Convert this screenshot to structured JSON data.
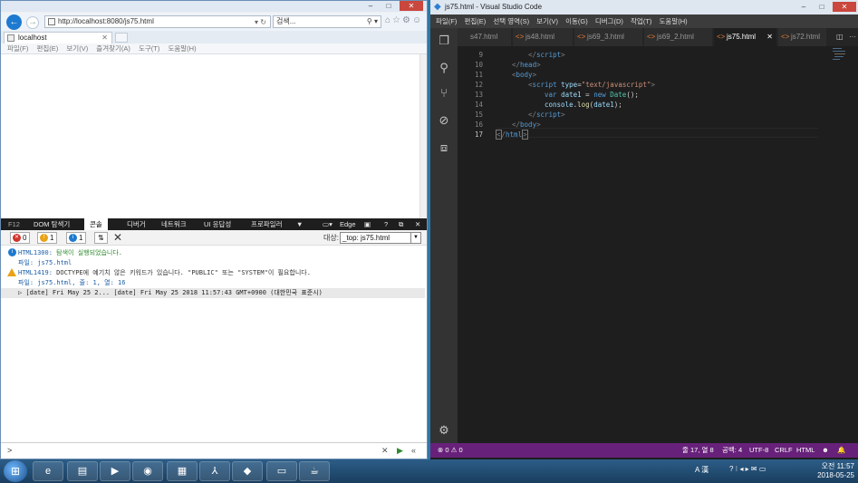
{
  "ie": {
    "title": "",
    "url": "http://localhost:8080/js75.html",
    "search_placeholder": "검색...",
    "tab_title": "localhost",
    "menu": [
      "파일(F)",
      "편집(E)",
      "보기(V)",
      "즐겨찾기(A)",
      "도구(T)",
      "도움말(H)"
    ]
  },
  "f12": {
    "tabs": [
      "F12",
      "DOM 탐색기",
      "콘솔",
      "디버거",
      "네트워크",
      "UI 응답성",
      "프로파일러",
      "Edge"
    ],
    "active_tab": "콘솔",
    "error_count": "0",
    "warning_count": "1",
    "info_count": "1",
    "target_label": "대상:",
    "target_value": "_top: js75.html",
    "messages": [
      {
        "type": "info",
        "code": "HTML1300:",
        "text": "탐색이 실행되었습니다.",
        "file": "파일: js75.html"
      },
      {
        "type": "warning",
        "code": "HTML1419:",
        "text": "DOCTYPE에 예기치 않은 키워드가 있습니다. \"PUBLIC\" 또는 \"SYSTEM\"이 필요합니다.",
        "file": "파일: js75.html, 줄: 1, 열: 16"
      }
    ],
    "date_log": "▷ [date] Fri May 25 2...  [date] Fri May 25 2018 11:57:43 GMT+0900 (대한민국 표준시)",
    "prompt": ">"
  },
  "vscode": {
    "title": "js75.html - Visual Studio Code",
    "menu": [
      "파일(F)",
      "편집(E)",
      "선택 영역(S)",
      "보기(V)",
      "이동(G)",
      "디버그(D)",
      "작업(T)",
      "도움말(H)"
    ],
    "tabs": [
      "s47.html",
      "js48.html",
      "js69_3.html",
      "js69_2.html",
      "js75.html",
      "js72.html"
    ],
    "active_tab": "js75.html",
    "line_numbers": [
      "9",
      "10",
      "11",
      "12",
      "13",
      "14",
      "15",
      "16",
      "17"
    ],
    "status": {
      "errors": "0",
      "warnings": "0",
      "position": "줄 17, 열 8",
      "spaces": "공백: 4",
      "encoding": "UTF-8",
      "eol": "CRLF",
      "language": "HTML"
    }
  },
  "tray": {
    "time": "오전 11:57",
    "date": "2018-05-25",
    "ime": "A 漢"
  },
  "colors": {
    "vscode_status": "#68217a",
    "ie_accent": "#1e7ad0",
    "taskbar": "#1a3e5f"
  }
}
